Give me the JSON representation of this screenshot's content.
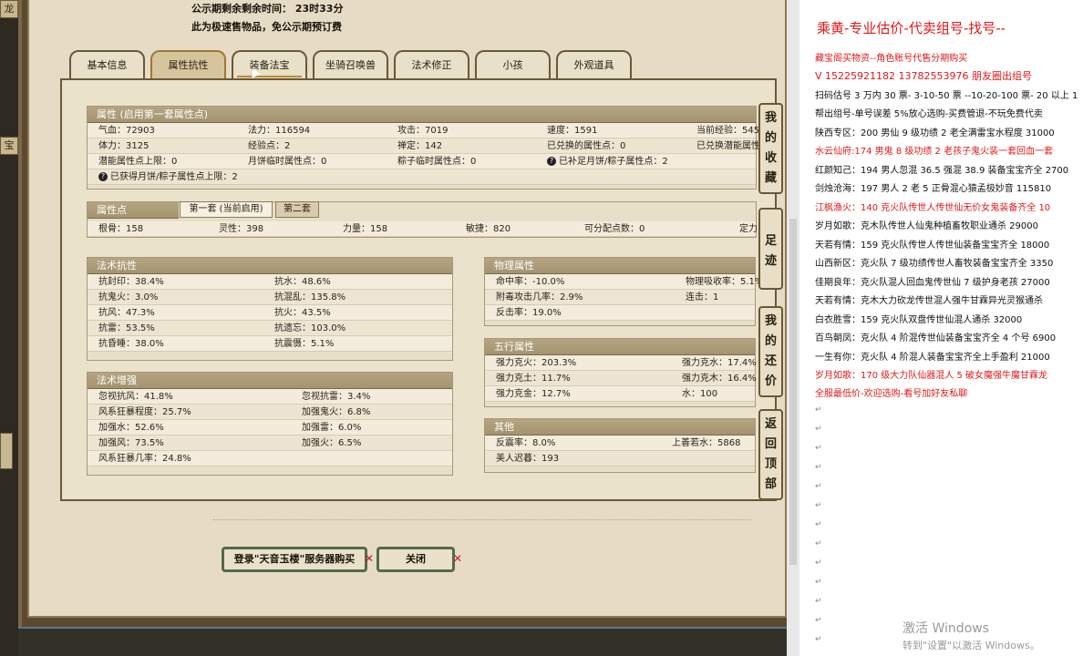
{
  "left_strip": {
    "tab_top": "龙服",
    "tab_mid": "宝"
  },
  "notice": {
    "line1": "公示期剩余剩余时间：  23时33分",
    "line2": "此为极速售物品，免公示期预订费"
  },
  "tabs": [
    "基本信息",
    "属性抗性",
    "装备法宝",
    "坐骑召唤兽",
    "法术修正",
    "小孩",
    "外观道具"
  ],
  "attr_section": {
    "title": "属性 (启用第一套属性点)",
    "rows": [
      [
        "气血：72903",
        "法力：116594",
        "攻击：7019",
        "速度：1591",
        "当前经验：545"
      ],
      [
        "体力：3125",
        "经验点：2",
        "禅定：142",
        "已兑换的属性点：0",
        "已兑换潜能属性"
      ],
      [
        "潜能属性点上限：0",
        "月饼临时属性点：0",
        "粽子临时属性点：0",
        "已补足月饼/粽子属性点：2",
        ""
      ],
      [
        "已获得月饼/粽子属性点上限：2",
        "",
        "",
        "",
        ""
      ]
    ]
  },
  "points_section": {
    "title": "属性点",
    "subtab1": "第一套 (当前启用)",
    "subtab2": "第二套",
    "row": [
      "根骨：158",
      "灵性：398",
      "力量：158",
      "敏捷：820",
      "可分配点数：0",
      "定力"
    ]
  },
  "resist_section": {
    "title": "法术抗性",
    "rows": [
      [
        "抗封印：38.4%",
        "抗水：48.6%"
      ],
      [
        "抗鬼火：3.0%",
        "抗混乱：135.8%"
      ],
      [
        "抗风：47.3%",
        "抗火：43.5%"
      ],
      [
        "抗雷：53.5%",
        "抗遗忘：103.0%"
      ],
      [
        "抗昏睡：38.0%",
        "抗震慑：5.1%"
      ]
    ]
  },
  "enhance_section": {
    "title": "法术增强",
    "rows": [
      [
        "忽视抗风：41.8%",
        "忽视抗雷：3.4%"
      ],
      [
        "风系狂暴程度：25.7%",
        "加强鬼火：6.8%"
      ],
      [
        "加强水：52.6%",
        "加强雷：6.0%"
      ],
      [
        "加强风：73.5%",
        "加强火：6.5%"
      ],
      [
        "风系狂暴几率：24.8%",
        ""
      ]
    ]
  },
  "physical_section": {
    "title": "物理属性",
    "rows": [
      [
        "命中率：-10.0%",
        "物理吸收率：5.1%"
      ],
      [
        "附毒攻击几率：2.9%",
        "连击：1"
      ],
      [
        "反击率：19.0%",
        ""
      ]
    ]
  },
  "five_section": {
    "title": "五行属性",
    "rows": [
      [
        "强力克火：203.3%",
        "强力克水：17.4%"
      ],
      [
        "强力克土：11.7%",
        "强力克木：16.4%"
      ],
      [
        "强力克金：12.7%",
        "水：100"
      ]
    ]
  },
  "other_section": {
    "title": "其他",
    "rows": [
      [
        "反震率：8.0%",
        "上善若水：5868"
      ],
      [
        "美人迟暮：193",
        ""
      ]
    ]
  },
  "side_buttons": [
    [
      "我",
      "的",
      "收",
      "藏"
    ],
    [
      "足",
      "迹"
    ],
    [
      "我",
      "的",
      "还",
      "价"
    ],
    [
      "返",
      "回",
      "顶",
      "部"
    ]
  ],
  "buttons": {
    "login": "登录\"天音玉楼\"服务器购买",
    "close": "关闭"
  },
  "doc": {
    "title": "乘黄-专业估价-代卖组号-找号--",
    "lines": [
      {
        "text": "藏宝阁买物资--角色账号代售分期购买",
        "red": true
      },
      {
        "text": "V 15225921182    13782553976 朋友圈出组号",
        "red": true
      },
      {
        "text": "扫码估号 3 万内 30 票- 3-10-50 票  --10-20-100 票- 20 以上 1",
        "red": false
      },
      {
        "text": "帮出组号-单号误差 5%放心选购-买费管退-不玩免费代卖",
        "red": false
      },
      {
        "text": "陕西专区：200 男仙 9 级功绩 2 老全满雷宝水程度 31000",
        "red": false
      },
      {
        "text": "水云仙府:174 男鬼 8 级功绩 2 老孩子鬼火装一套回血一套",
        "red": true
      },
      {
        "text": "红颜知己：194 男人忽混 36.5 强混 38.9 装备宝宝齐全 2700",
        "red": false
      },
      {
        "text": "剑烛沧海：197 男人 2 老 5 正骨混心猿孟极妙音 115810",
        "red": false
      },
      {
        "text": "江枫渔火：140 克火队传世人传世仙无价女鬼装备齐全 10",
        "red": true
      },
      {
        "text": "岁月如歌：克木队传世人仙鬼种植畜牧职业通杀 29000",
        "red": false
      },
      {
        "text": "天若有情：159 克火队传世人传世仙装备宝宝齐全 18000",
        "red": false
      },
      {
        "text": "山西新区：克火队 7 级功绩传世人畜牧装备宝宝齐全 3350",
        "red": false
      },
      {
        "text": "佳期良年：克火队混人回血鬼传世仙 7 级护身老孩 27000",
        "red": false
      },
      {
        "text": "天若有情：克木大力砍龙传世混人强牛甘霖异光灵猴通杀",
        "red": false
      },
      {
        "text": "白衣胜雪：159 克火队双盘传世仙混人通杀 32000",
        "red": false
      },
      {
        "text": "百鸟朝凤：克火队 4 阶混传世仙装备宝宝齐全 4 个号 6900",
        "red": false
      },
      {
        "text": "一生有你：克火队 4 阶混人装备宝宝齐全上手盈利 21000",
        "red": false
      },
      {
        "text": "岁月如歌：170 级大力队仙器混人 5 破女魔强牛魔甘霖龙",
        "red": true
      },
      {
        "text": "全服最低价-欢迎选购-看号加好友私聊",
        "red": true
      }
    ],
    "para_mark": "↵",
    "watermark": "激活 Windows",
    "watermark_sub": "转到\"设置\"以激活 Windows。"
  },
  "colors": {
    "accent_red": "#e01818",
    "panel": "#e6dcc6",
    "header": "#a3936f"
  }
}
